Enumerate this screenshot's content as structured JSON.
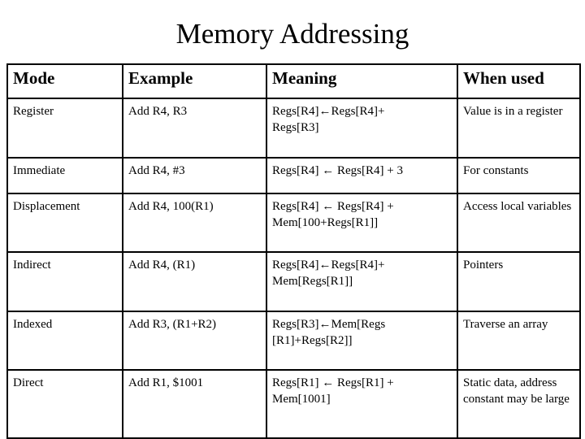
{
  "slide": {
    "title": "Memory Addressing"
  },
  "table": {
    "headers": [
      "Mode",
      "Example",
      "Meaning",
      "When used"
    ],
    "rows": [
      {
        "mode": "Register",
        "example": "Add R4, R3",
        "meaning": "Regs[R4]←Regs[R4]+\nRegs[R3]",
        "when_used": "Value is in a register"
      },
      {
        "mode": "Immediate",
        "example": "Add R4, #3",
        "meaning": "Regs[R4] ← Regs[R4] + 3",
        "when_used": "For constants"
      },
      {
        "mode": "Displacement",
        "example": "Add R4, 100(R1)",
        "meaning": "Regs[R4] ← Regs[R4] +\nMem[100+Regs[R1]]",
        "when_used": "Access local variables"
      },
      {
        "mode": "Indirect",
        "example": "Add R4, (R1)",
        "meaning": "Regs[R4]←Regs[R4]+\nMem[Regs[R1]]",
        "when_used": "Pointers"
      },
      {
        "mode": "Indexed",
        "example": "Add R3, (R1+R2)",
        "meaning": "Regs[R3]←Mem[Regs\n[R1]+Regs[R2]]",
        "when_used": "Traverse an array"
      },
      {
        "mode": "Direct",
        "example": "Add R1, $1001",
        "meaning": "Regs[R1] ← Regs[R1] +\nMem[1001]",
        "when_used": "Static data, address constant may be large"
      }
    ]
  },
  "colors": {
    "background": "#ffffff",
    "text": "#000000",
    "border": "#000000"
  }
}
